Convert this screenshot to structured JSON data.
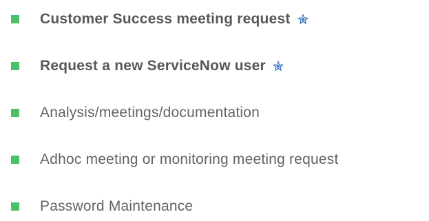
{
  "catalog_list": {
    "items": [
      {
        "label": "Customer Success meeting request",
        "featured": true,
        "star_icon": "star-icon"
      },
      {
        "label": "Request a new ServiceNow user",
        "featured": true,
        "star_icon": "star-icon"
      },
      {
        "label": "Analysis/meetings/documentation",
        "featured": false
      },
      {
        "label": "Adhoc meeting or monitoring meeting request",
        "featured": false
      },
      {
        "label": "Password Maintenance",
        "featured": false
      }
    ]
  },
  "colors": {
    "bullet": "#49c166",
    "star_fill": "#1e63b5",
    "star_outline": "#ffffff",
    "text": "#5f6368"
  }
}
